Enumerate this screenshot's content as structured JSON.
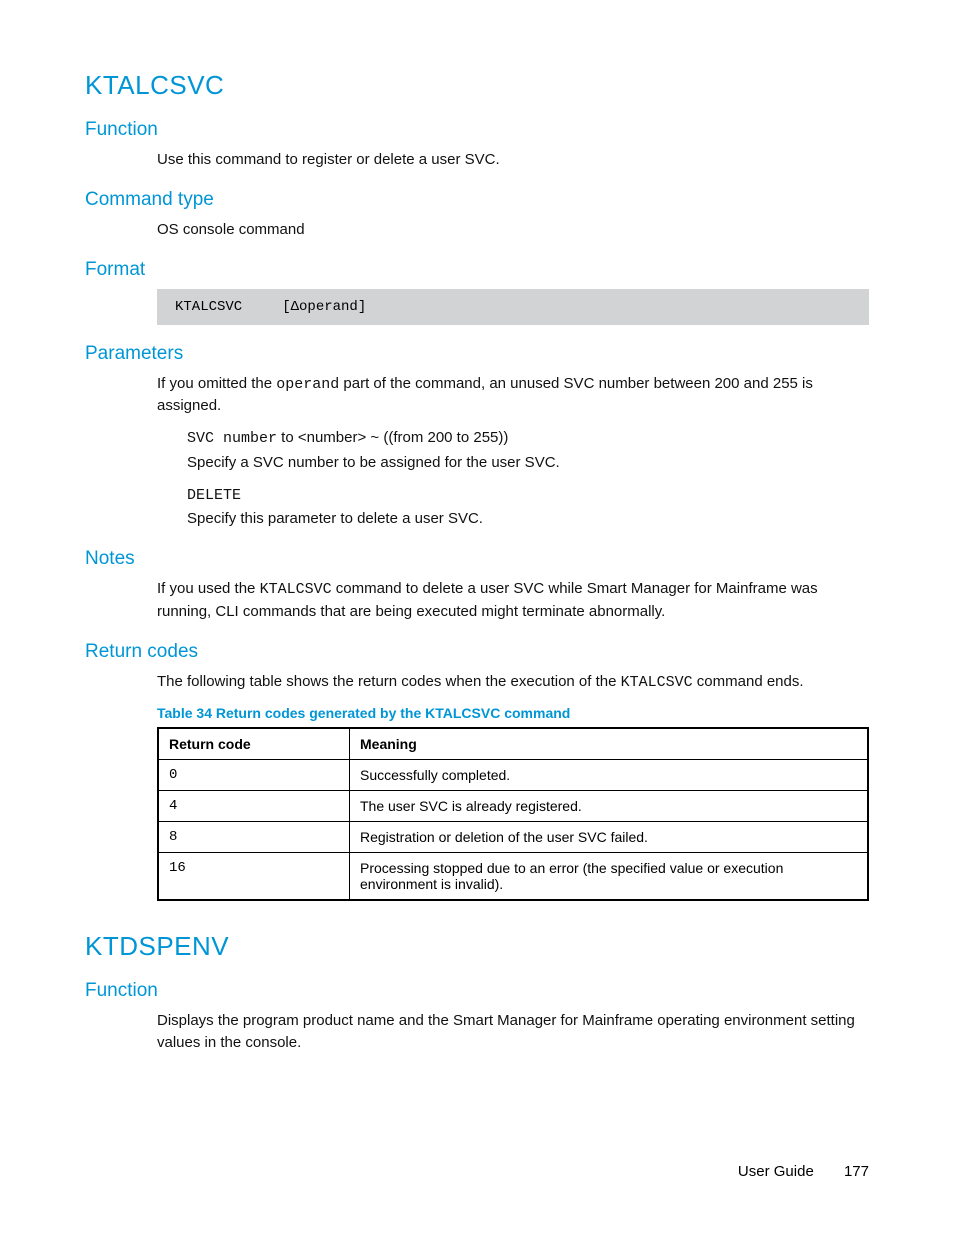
{
  "section1": {
    "title": "KTALCSVC",
    "function_h": "Function",
    "function_text": "Use this command to register or delete a user SVC.",
    "cmdtype_h": "Command type",
    "cmdtype_text": "OS console command",
    "format_h": "Format",
    "format_code_left": "KTALCSVC",
    "format_code_right": "[Δoperand]",
    "params_h": "Parameters",
    "params_intro_pre": "If you omitted the ",
    "params_intro_mono": "operand",
    "params_intro_post": " part of the command, an unused SVC number between 200 and 255 is assigned.",
    "param1_name": "SVC number",
    "param1_spec": " to <number> ~ ((from 200 to 255))",
    "param1_desc": "Specify a SVC number to be assigned for the user SVC.",
    "param2_name": "DELETE",
    "param2_desc": "Specify this parameter to delete a user SVC.",
    "notes_h": "Notes",
    "notes_pre": "If you used the ",
    "notes_mono": "KTALCSVC",
    "notes_post": " command to delete a user SVC while Smart Manager for Mainframe was running, CLI commands that are being executed might terminate abnormally.",
    "rc_h": "Return codes",
    "rc_intro_pre": "The following table shows the return codes when the execution of the ",
    "rc_intro_mono": "KTALCSVC",
    "rc_intro_post": " command ends.",
    "table_caption": "Table 34 Return codes generated by the KTALCSVC command",
    "th1": "Return code",
    "th2": "Meaning",
    "rows": [
      {
        "code": "0",
        "meaning": "Successfully completed."
      },
      {
        "code": "4",
        "meaning": "The user SVC is already registered."
      },
      {
        "code": "8",
        "meaning": "Registration or deletion of the user SVC failed."
      },
      {
        "code": "16",
        "meaning": "Processing stopped due to an error (the specified value or execution environment is invalid)."
      }
    ]
  },
  "section2": {
    "title": "KTDSPENV",
    "function_h": "Function",
    "function_text": "Displays the program product name and the Smart Manager for Mainframe operating environment setting values in the console."
  },
  "footer": {
    "doc": "User Guide",
    "page": "177"
  }
}
